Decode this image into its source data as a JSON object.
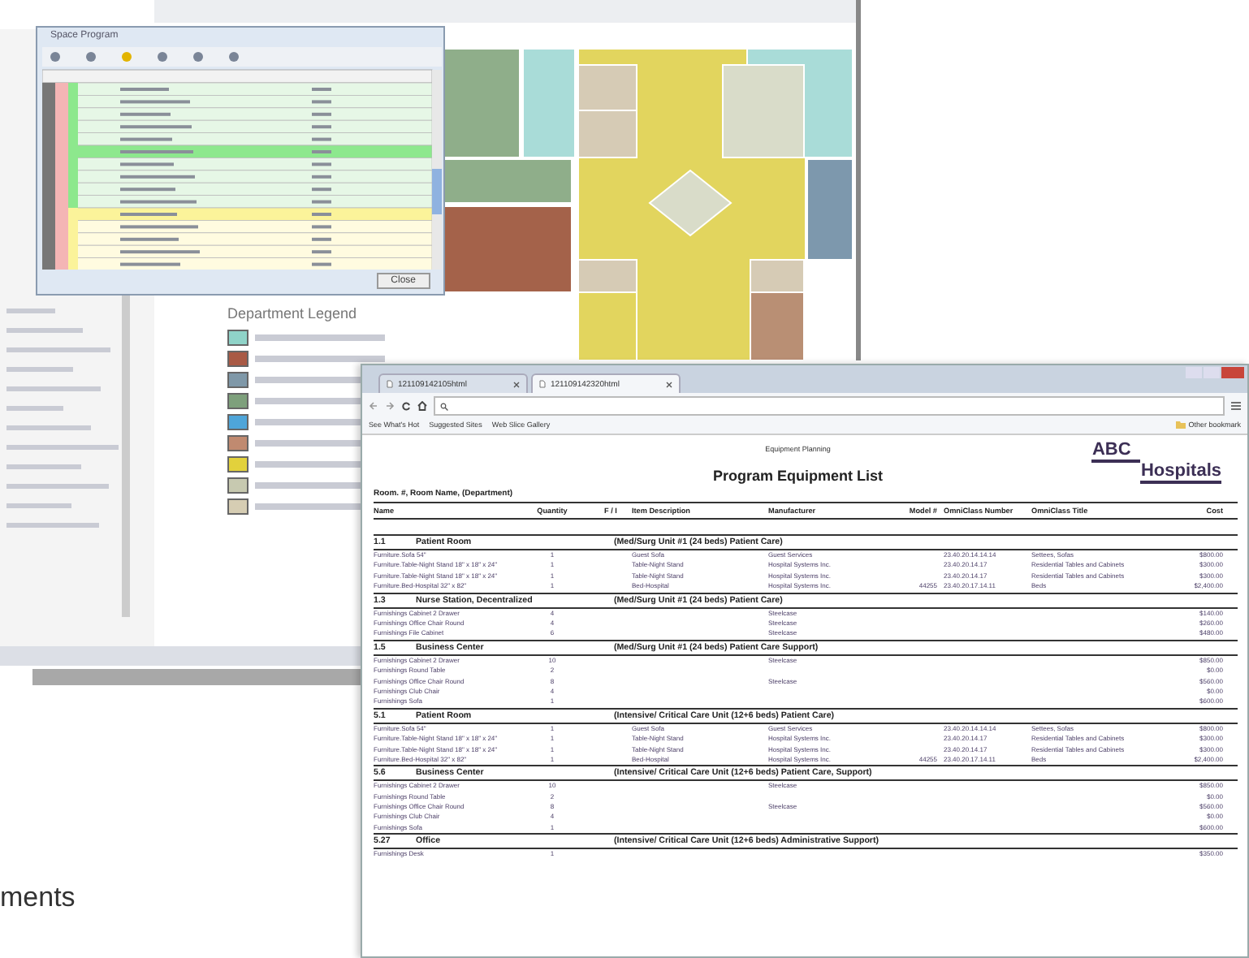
{
  "background_app": {
    "dialog": {
      "title": "Space Program",
      "close_button": "Close"
    },
    "legend": {
      "title": "Department Legend",
      "swatches": [
        {
          "color": "#8fd3c8"
        },
        {
          "color": "#a95a45"
        },
        {
          "color": "#7f98a8"
        },
        {
          "color": "#7ea07c"
        },
        {
          "color": "#4ea5d9"
        },
        {
          "color": "#c08a70"
        },
        {
          "color": "#e2d13c"
        },
        {
          "color": "#c7c9b0"
        },
        {
          "color": "#d6cdb3"
        }
      ]
    }
  },
  "caption_fragment": "ments",
  "browser": {
    "tabs": [
      {
        "label": "121109142105html",
        "selected": false
      },
      {
        "label": "121109142320html",
        "selected": true
      }
    ],
    "bookmarks": [
      "See What's Hot",
      "Suggested Sites",
      "Web Slice Gallery"
    ],
    "other_bookmarks": "Other bookmark",
    "report": {
      "subtitle": "Equipment Planning",
      "title": "Program Equipment List",
      "logo": {
        "top": "ABC",
        "bottom": "Hospitals"
      },
      "group_label": "Room. #, Room Name, (Department)",
      "columns": [
        "Name",
        "Quantity",
        "F / I",
        "Item Description",
        "Manufacturer",
        "Model #",
        "OmniClass Number",
        "OmniClass Title",
        "Cost"
      ],
      "sections": [
        {
          "number": "1.1",
          "room": "Patient Room",
          "department": "(Med/Surg Unit #1 (24 beds) Patient Care)",
          "rows": [
            [
              "Furniture.Sofa 54\"",
              "1",
              "",
              "Guest Sofa",
              "Guest Services",
              "",
              "23.40.20.14.14.14",
              "Settees, Sofas",
              "$800.00"
            ],
            [
              "Furniture.Table-Night Stand 18\" x 18\" x 24\"",
              "1",
              "",
              "Table-Night Stand",
              "Hospital Systems Inc.",
              "",
              "23.40.20.14.17",
              "Residential Tables and Cabinets",
              "$300.00"
            ],
            [
              "Furniture.Table-Night Stand 18\" x 18\" x 24\"",
              "1",
              "",
              "Table-Night Stand",
              "Hospital Systems Inc.",
              "",
              "23.40.20.14.17",
              "Residential Tables and Cabinets",
              "$300.00"
            ],
            [
              "Furniture.Bed-Hospital 32\" x 82\"",
              "1",
              "",
              "Bed-Hospital",
              "Hospital Systems Inc.",
              "44255",
              "23.40.20.17.14.11",
              "Beds",
              "$2,400.00"
            ]
          ]
        },
        {
          "number": "1.3",
          "room": "Nurse Station, Decentralized",
          "department": "(Med/Surg Unit #1 (24 beds) Patient Care)",
          "rows": [
            [
              "Furnishings Cabinet 2 Drawer",
              "4",
              "",
              "",
              "Steelcase",
              "",
              "",
              "",
              "$140.00"
            ],
            [
              "Furnishings Office Chair Round",
              "4",
              "",
              "",
              "Steelcase",
              "",
              "",
              "",
              "$260.00"
            ],
            [
              "Furnishings File Cabinet",
              "6",
              "",
              "",
              "Steelcase",
              "",
              "",
              "",
              "$480.00"
            ]
          ]
        },
        {
          "number": "1.5",
          "room": "Business Center",
          "department": "(Med/Surg Unit #1 (24 beds) Patient Care Support)",
          "rows": [
            [
              "Furnishings Cabinet 2 Drawer",
              "10",
              "",
              "",
              "Steelcase",
              "",
              "",
              "",
              "$850.00"
            ],
            [
              "Furnishings Round Table",
              "2",
              "",
              "",
              "",
              "",
              "",
              "",
              "$0.00"
            ],
            [
              "Furnishings Office Chair Round",
              "8",
              "",
              "",
              "Steelcase",
              "",
              "",
              "",
              "$560.00"
            ],
            [
              "Furnishings Club Chair",
              "4",
              "",
              "",
              "",
              "",
              "",
              "",
              "$0.00"
            ],
            [
              "Furnishings Sofa",
              "1",
              "",
              "",
              "",
              "",
              "",
              "",
              "$600.00"
            ]
          ]
        },
        {
          "number": "5.1",
          "room": "Patient Room",
          "department": "(Intensive/ Critical Care Unit (12+6 beds) Patient Care)",
          "rows": [
            [
              "Furniture.Sofa 54\"",
              "1",
              "",
              "Guest Sofa",
              "Guest Services",
              "",
              "23.40.20.14.14.14",
              "Settees, Sofas",
              "$800.00"
            ],
            [
              "Furniture.Table-Night Stand 18\" x 18\" x 24\"",
              "1",
              "",
              "Table-Night Stand",
              "Hospital Systems Inc.",
              "",
              "23.40.20.14.17",
              "Residential Tables and Cabinets",
              "$300.00"
            ],
            [
              "Furniture.Table-Night Stand 18\" x 18\" x 24\"",
              "1",
              "",
              "Table-Night Stand",
              "Hospital Systems Inc.",
              "",
              "23.40.20.14.17",
              "Residential Tables and Cabinets",
              "$300.00"
            ],
            [
              "Furniture.Bed-Hospital 32\" x 82\"",
              "1",
              "",
              "Bed-Hospital",
              "Hospital Systems Inc.",
              "44255",
              "23.40.20.17.14.11",
              "Beds",
              "$2,400.00"
            ]
          ]
        },
        {
          "number": "5.6",
          "room": "Business Center",
          "department": "(Intensive/ Critical Care Unit (12+6 beds) Patient Care, Support)",
          "rows": [
            [
              "Furnishings Cabinet 2 Drawer",
              "10",
              "",
              "",
              "Steelcase",
              "",
              "",
              "",
              "$850.00"
            ],
            [
              "Furnishings Round Table",
              "2",
              "",
              "",
              "",
              "",
              "",
              "",
              "$0.00"
            ],
            [
              "Furnishings Office Chair Round",
              "8",
              "",
              "",
              "Steelcase",
              "",
              "",
              "",
              "$560.00"
            ],
            [
              "Furnishings Club Chair",
              "4",
              "",
              "",
              "",
              "",
              "",
              "",
              "$0.00"
            ],
            [
              "Furnishings Sofa",
              "1",
              "",
              "",
              "",
              "",
              "",
              "",
              "$600.00"
            ]
          ]
        },
        {
          "number": "5.27",
          "room": "Office",
          "department": "(Intensive/ Critical Care Unit (12+6 beds) Administrative Support)",
          "rows": [
            [
              "Furnishings Desk",
              "1",
              "",
              "",
              "",
              "",
              "",
              "",
              "$350.00"
            ]
          ]
        }
      ]
    }
  }
}
